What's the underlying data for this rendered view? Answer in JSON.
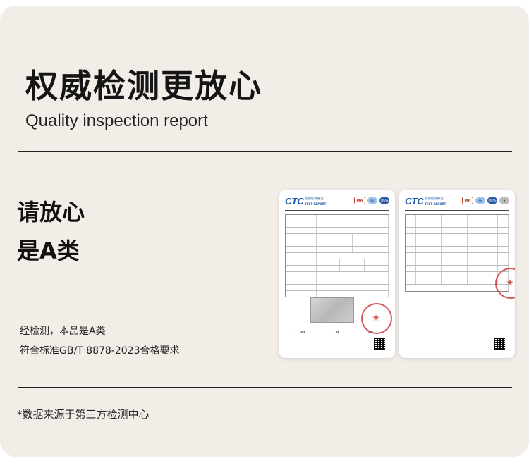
{
  "title": "权威检测更放心",
  "subtitle": "Quality inspection report",
  "headline": [
    "请放心",
    "是A类"
  ],
  "description": [
    "经检测，本品是A类",
    "符合标准GB/T 8878-2023合格要求"
  ],
  "footnote": "*数据来源于第三方检测中心",
  "report": {
    "logo": "CTC",
    "logo_sub": "检验检测报告",
    "logo_sub2": "TEST REPORT",
    "marks": [
      "MA",
      "ilac",
      "CNAS",
      "★"
    ]
  },
  "colors": {
    "background": "#f3ede8",
    "text": "#1a1a1a",
    "logo_blue": "#1f5aa8",
    "stamp_red": "#d03b3b"
  }
}
